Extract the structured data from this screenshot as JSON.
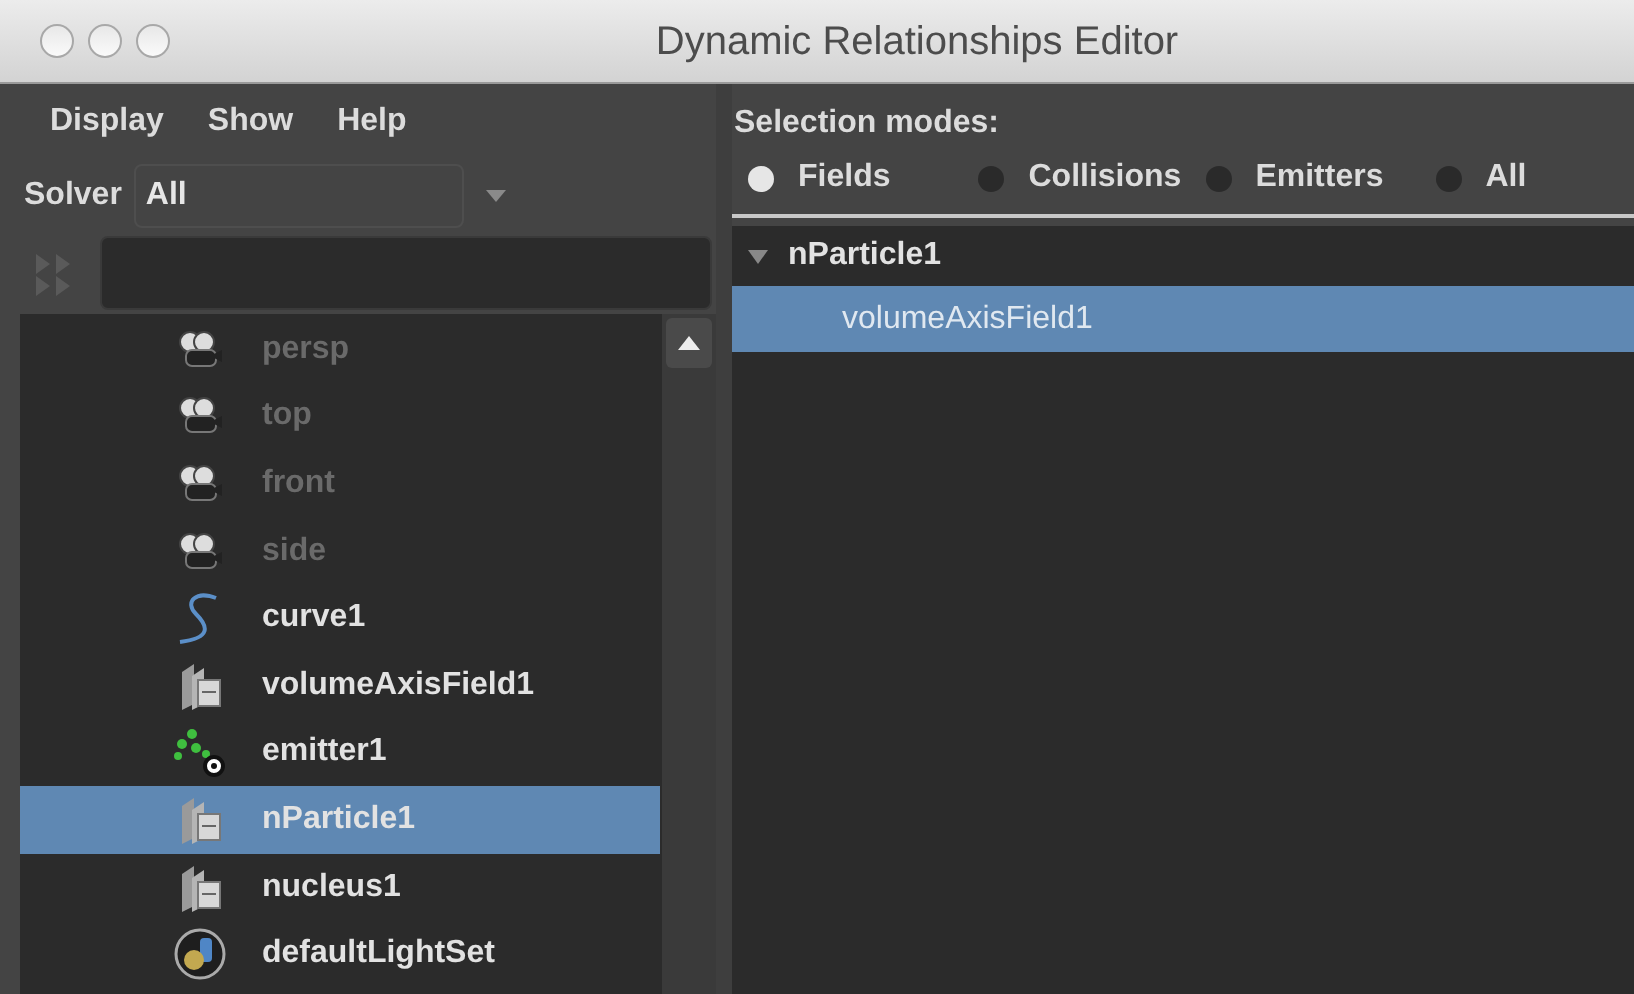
{
  "window": {
    "title": "Dynamic Relationships Editor"
  },
  "menu": [
    "Display",
    "Show",
    "Help"
  ],
  "solver": {
    "label": "Solver",
    "value": "All"
  },
  "outliner": {
    "items": [
      {
        "label": "persp",
        "kind": "camera",
        "dimmed": true,
        "selected": false
      },
      {
        "label": "top",
        "kind": "camera",
        "dimmed": true,
        "selected": false
      },
      {
        "label": "front",
        "kind": "camera",
        "dimmed": true,
        "selected": false
      },
      {
        "label": "side",
        "kind": "camera",
        "dimmed": true,
        "selected": false
      },
      {
        "label": "curve1",
        "kind": "curve",
        "dimmed": false,
        "selected": false
      },
      {
        "label": "volumeAxisField1",
        "kind": "node",
        "dimmed": false,
        "selected": false
      },
      {
        "label": "emitter1",
        "kind": "emitter",
        "dimmed": false,
        "selected": false
      },
      {
        "label": "nParticle1",
        "kind": "node",
        "dimmed": false,
        "selected": true
      },
      {
        "label": "nucleus1",
        "kind": "node",
        "dimmed": false,
        "selected": false
      },
      {
        "label": "defaultLightSet",
        "kind": "lightset",
        "dimmed": false,
        "selected": false
      }
    ]
  },
  "selection_modes": {
    "label": "Selection modes:",
    "options": [
      {
        "label": "Fields",
        "selected": true
      },
      {
        "label": "Collisions",
        "selected": false
      },
      {
        "label": "Emitters",
        "selected": false
      },
      {
        "label": "All",
        "selected": false
      }
    ]
  },
  "tree": [
    {
      "label": "nParticle1",
      "expanded": true,
      "selected": false,
      "children": [
        {
          "label": "volumeAxisField1",
          "selected": true
        }
      ]
    }
  ]
}
